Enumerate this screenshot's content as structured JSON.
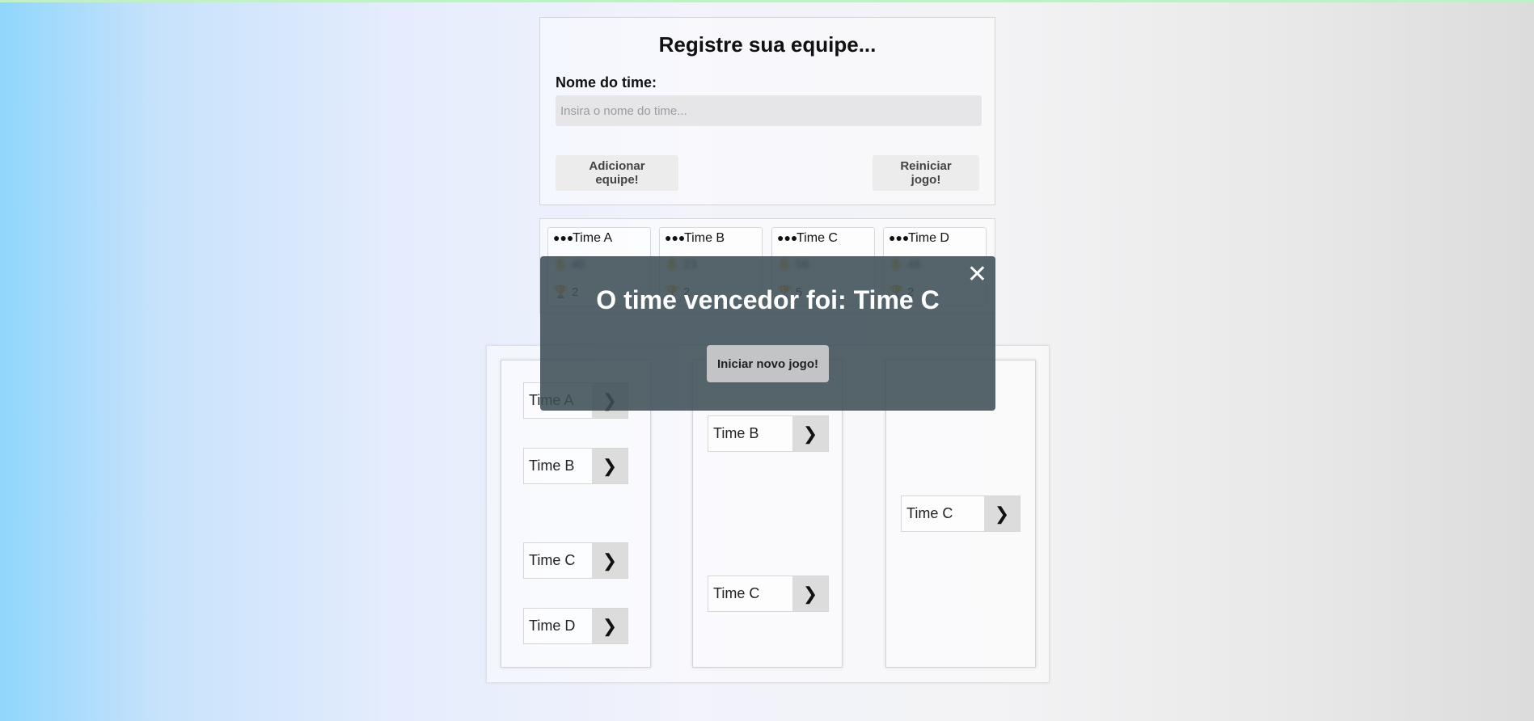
{
  "register": {
    "title": "Registre sua equipe...",
    "team_name_label": "Nome do time:",
    "team_name_placeholder": "Insira o nome do time...",
    "team_name_value": "",
    "add_button": "Adicionar equipe!",
    "reset_button": "Reiniciar jogo!"
  },
  "teams": [
    {
      "name": "Time A",
      "score": "40",
      "wins": "2"
    },
    {
      "name": "Time B",
      "score": "23",
      "wins": "2"
    },
    {
      "name": "Time C",
      "score": "56",
      "wins": "5"
    },
    {
      "name": "Time D",
      "score": "48",
      "wins": "2"
    }
  ],
  "icons": {
    "team": "team-icon",
    "score": "hand-icon",
    "trophy": "trophy-icon",
    "arrow": "chevron-right-icon",
    "close": "close-icon"
  },
  "bracket": {
    "round1": [
      "Time A",
      "Time B",
      "Time C",
      "Time D"
    ],
    "round2": [
      "Time B",
      "Time C"
    ],
    "final": [
      "Time C"
    ]
  },
  "modal": {
    "message": "O time vencedor foi: Time C",
    "new_game_button": "Iniciar novo jogo!"
  }
}
